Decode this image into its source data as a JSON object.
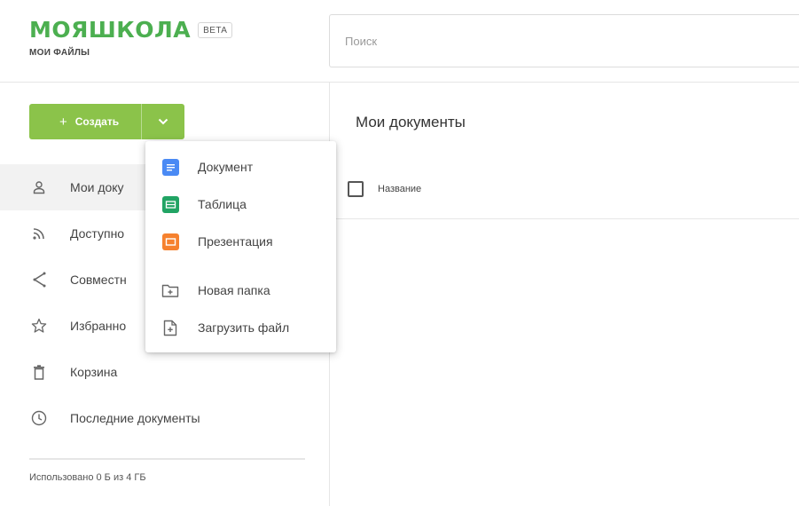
{
  "brand": {
    "logo": "МОЯШКОЛА",
    "badge": "BETA",
    "subtitle": "МОИ ФАЙЛЫ"
  },
  "search": {
    "placeholder": "Поиск"
  },
  "create": {
    "label": "Создать",
    "plus": "+"
  },
  "menu": {
    "items": [
      {
        "label": "Документ",
        "icon": "docs-icon",
        "color": "#4a8af4"
      },
      {
        "label": "Таблица",
        "icon": "sheets-icon",
        "color": "#21a464"
      },
      {
        "label": "Презентация",
        "icon": "slides-icon",
        "color": "#f6812e"
      },
      {
        "label": "Новая папка",
        "icon": "new-folder-icon"
      },
      {
        "label": "Загрузить файл",
        "icon": "upload-file-icon"
      }
    ]
  },
  "sidebar": {
    "items": [
      {
        "label": "Мои доку",
        "icon": "person-icon"
      },
      {
        "label": "Доступно",
        "icon": "rss-icon"
      },
      {
        "label": "Совместн",
        "icon": "share-icon"
      },
      {
        "label": "Избранно",
        "icon": "star-icon"
      },
      {
        "label": "Корзина",
        "icon": "trash-icon"
      },
      {
        "label": "Последние документы",
        "icon": "clock-icon"
      }
    ]
  },
  "storage": {
    "text": "Использовано 0 Б из 4 ГБ"
  },
  "main": {
    "title": "Мои документы",
    "columns": {
      "name": "Название"
    }
  },
  "colors": {
    "brand_green": "#4caf50",
    "button_green": "#8bc34a"
  }
}
